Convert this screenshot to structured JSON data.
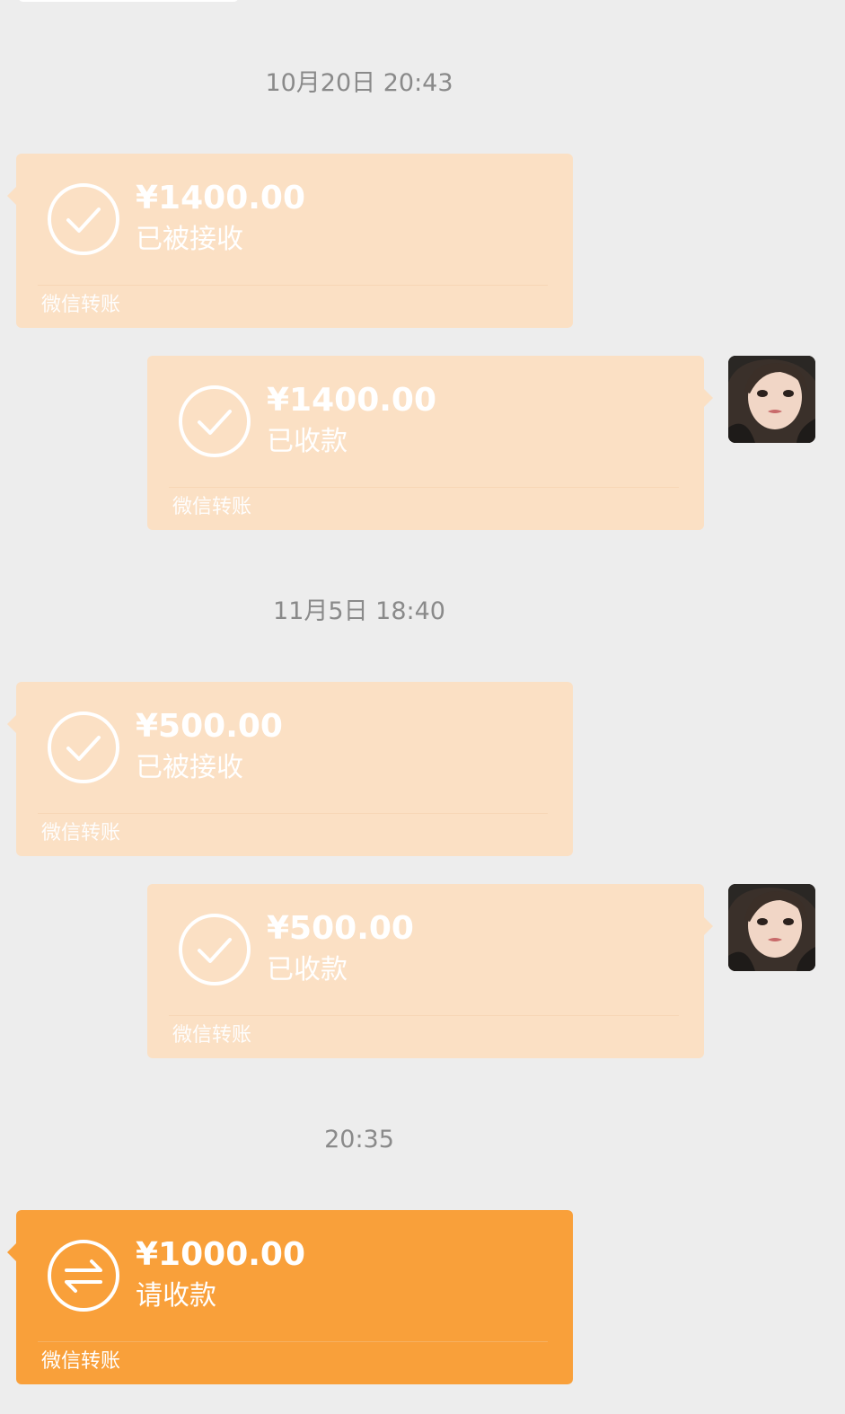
{
  "messages": [
    {
      "timestamp": "10月20日 20:43"
    },
    {
      "card": {
        "amount": "¥1400.00",
        "status": "已被接收",
        "footer": "微信转账"
      }
    },
    {
      "card": {
        "amount": "¥1400.00",
        "status": "已收款",
        "footer": "微信转账"
      }
    },
    {
      "timestamp": "11月5日 18:40"
    },
    {
      "card": {
        "amount": "¥500.00",
        "status": "已被接收",
        "footer": "微信转账"
      }
    },
    {
      "card": {
        "amount": "¥500.00",
        "status": "已收款",
        "footer": "微信转账"
      }
    },
    {
      "timestamp": "20:35"
    },
    {
      "card": {
        "amount": "¥1000.00",
        "status": "请收款",
        "footer": "微信转账"
      }
    }
  ],
  "colors": {
    "background": "#ededed",
    "transfer_done_bg": "#fbe0c4",
    "transfer_pending_bg": "#f9a03a",
    "timestamp_text": "#8a8a8a"
  },
  "icons": {
    "done": "check-circle-icon",
    "pending": "transfer-arrows-circle-icon"
  }
}
